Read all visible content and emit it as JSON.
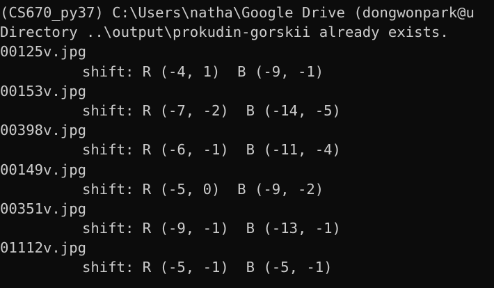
{
  "terminal": {
    "colors": {
      "background": "#0c0c0c",
      "foreground": "#cccccc"
    },
    "lines": [
      "(CS670_py37) C:\\Users\\natha\\Google Drive (dongwonpark@u",
      "Directory ..\\output\\prokudin-gorskii already exists.",
      "00125v.jpg",
      "shift: R (-4, 1)  B (-9, -1)",
      "00153v.jpg",
      "shift: R (-7, -2)  B (-14, -5)",
      "00398v.jpg",
      "shift: R (-6, -1)  B (-11, -4)",
      "00149v.jpg",
      "shift: R (-5, 0)  B (-9, -2)",
      "00351v.jpg",
      "shift: R (-9, -1)  B (-13, -1)",
      "01112v.jpg",
      "shift: R (-5, -1)  B (-5, -1)"
    ]
  }
}
